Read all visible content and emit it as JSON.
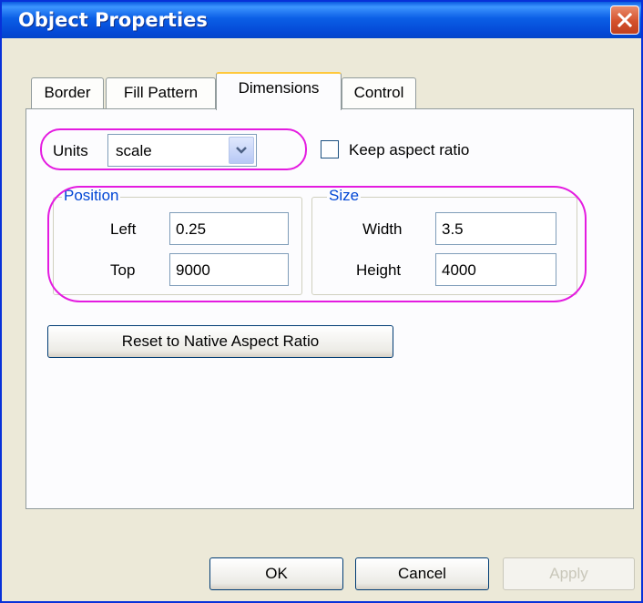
{
  "window": {
    "title": "Object Properties"
  },
  "tabs": [
    {
      "label": "Border"
    },
    {
      "label": "Fill Pattern"
    },
    {
      "label": "Dimensions"
    },
    {
      "label": "Control"
    }
  ],
  "units": {
    "label": "Units",
    "value": "scale"
  },
  "keep_aspect": {
    "label": "Keep aspect ratio",
    "checked": false
  },
  "position": {
    "title": "Position",
    "left_label": "Left",
    "left_value": "0.25",
    "top_label": "Top",
    "top_value": "9000"
  },
  "size": {
    "title": "Size",
    "width_label": "Width",
    "width_value": "3.5",
    "height_label": "Height",
    "height_value": "4000"
  },
  "reset_button": {
    "label": "Reset to Native Aspect Ratio"
  },
  "footer": {
    "ok": "OK",
    "cancel": "Cancel",
    "apply": "Apply"
  },
  "colors": {
    "title_bar": "#0A5BE0",
    "highlight": "#E41BE0",
    "group_title": "#0046D5"
  },
  "icons": {
    "close": "close-icon",
    "dropdown": "chevron-down-icon"
  }
}
